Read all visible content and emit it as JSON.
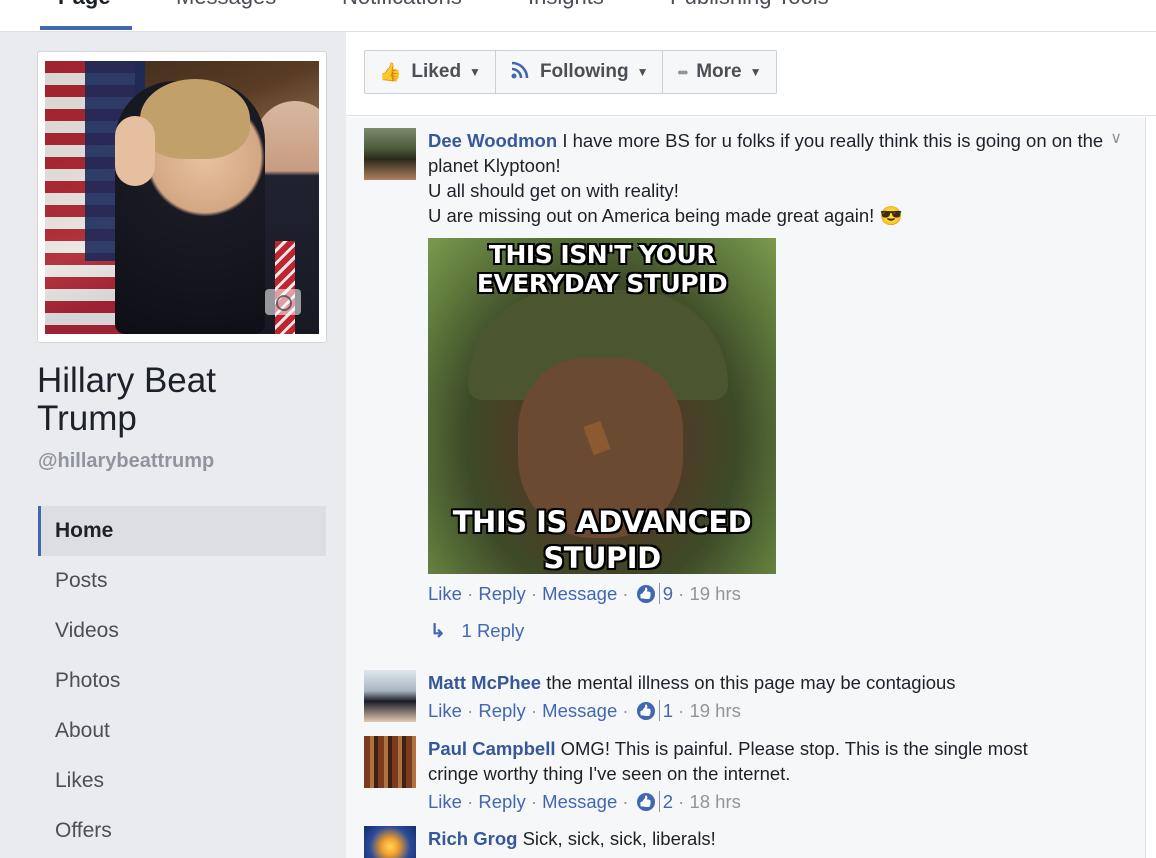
{
  "top_tabs": [
    {
      "label": "Page",
      "active": true
    },
    {
      "label": "Messages"
    },
    {
      "label": "Notifications"
    },
    {
      "label": "Insights"
    },
    {
      "label": "Publishing Tools"
    }
  ],
  "page": {
    "name": "Hillary Beat Trump",
    "handle": "@hillarybeattrump"
  },
  "nav": {
    "items": [
      "Home",
      "Posts",
      "Videos",
      "Photos",
      "About",
      "Likes",
      "Offers"
    ],
    "active": "Home"
  },
  "actions": {
    "liked": "Liked",
    "following": "Following",
    "more": "More"
  },
  "comments": [
    {
      "author": "Dee Woodmon",
      "lines": [
        "I have more BS for u folks if you really think this is going on on the planet Klyptoon!",
        "U all should get on with reality!",
        "U are missing out on America being made great again! 😎"
      ],
      "meme_top": "THIS ISN'T YOUR EVERYDAY STUPID",
      "meme_bottom": "THIS IS ADVANCED STUPID",
      "like": "Like",
      "reply": "Reply",
      "message": "Message",
      "like_count": "9",
      "time": "19 hrs",
      "replies_label": "1 Reply"
    },
    {
      "author": "Matt McPhee",
      "text": "the mental illness on this page may be contagious",
      "like": "Like",
      "reply": "Reply",
      "message": "Message",
      "like_count": "1",
      "time": "19 hrs"
    },
    {
      "author": "Paul Campbell",
      "text": "OMG! This is painful. Please stop. This is the single most cringe worthy thing I've seen on the internet.",
      "like": "Like",
      "reply": "Reply",
      "message": "Message",
      "like_count": "2",
      "time": "18 hrs"
    },
    {
      "author": "Rich Grog",
      "text": "Sick, sick, sick, liberals!"
    }
  ],
  "colors": {
    "link": "#365899",
    "accent": "#4267b2",
    "muted": "#90949c",
    "background": "#e9ebee"
  }
}
